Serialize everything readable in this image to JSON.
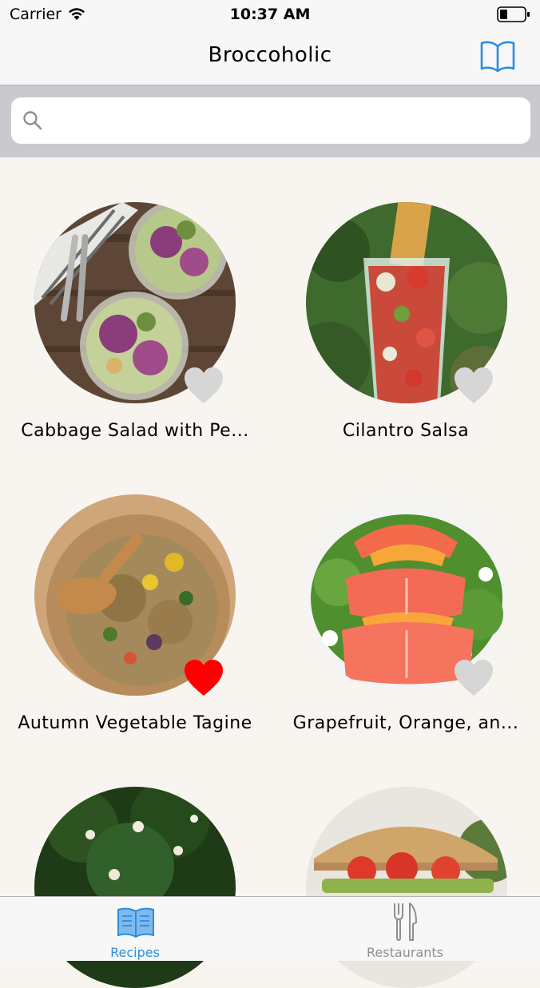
{
  "status_bar": {
    "carrier": "Carrier",
    "time": "10:37 AM"
  },
  "nav": {
    "title": "Broccoholic",
    "bookmark_icon": "book-icon"
  },
  "search": {
    "placeholder": "",
    "value": ""
  },
  "recipes": [
    {
      "title": "Cabbage Salad with Pe...",
      "favorite": false
    },
    {
      "title": "Cilantro Salsa",
      "favorite": false
    },
    {
      "title": "Autumn Vegetable Tagine",
      "favorite": true
    },
    {
      "title": "Grapefruit, Orange, an...",
      "favorite": false
    },
    {
      "title": "",
      "favorite": false
    },
    {
      "title": "",
      "favorite": false
    }
  ],
  "tabs": [
    {
      "label": "Recipes",
      "icon": "open-book-icon",
      "selected": true
    },
    {
      "label": "Restaurants",
      "icon": "fork-knife-icon",
      "selected": false
    }
  ],
  "colors": {
    "accent": "#2a8ee3",
    "favorite": "#ff0000",
    "not_favorite": "#d6d6d6",
    "inactive_tab": "#8e8e93",
    "background": "#f8f5f1"
  }
}
